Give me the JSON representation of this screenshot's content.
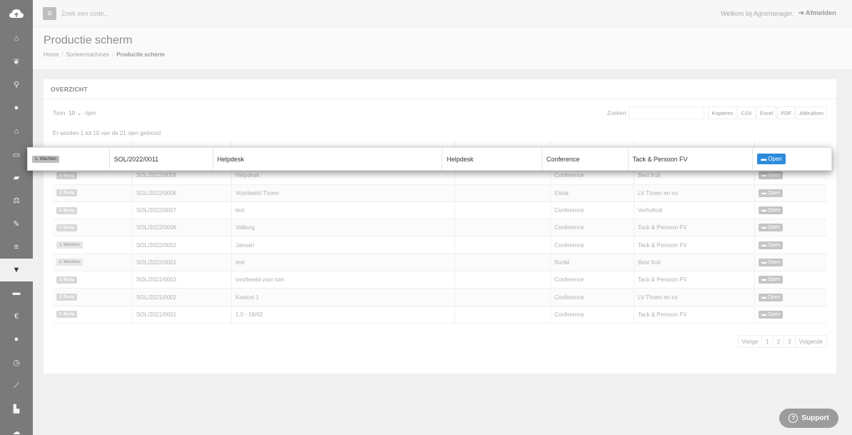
{
  "sidebar": {
    "logo_icon": "cloud-icon",
    "items": [
      {
        "icon": "home-icon",
        "glyph": "⌂"
      },
      {
        "icon": "leaf-icon",
        "glyph": "❦"
      },
      {
        "icon": "map-marker-icon",
        "glyph": "⚲"
      },
      {
        "icon": "tint-icon",
        "glyph": "●"
      },
      {
        "icon": "bank-icon",
        "glyph": "⌂"
      },
      {
        "icon": "basket-icon",
        "glyph": "▭"
      },
      {
        "icon": "book-icon",
        "glyph": "▰"
      },
      {
        "icon": "balance-scale-icon",
        "glyph": "⚖"
      },
      {
        "icon": "wrench-icon",
        "glyph": "✎"
      },
      {
        "icon": "list-icon",
        "glyph": "≡"
      },
      {
        "icon": "filter-icon",
        "glyph": "▼"
      },
      {
        "icon": "truck-icon",
        "glyph": "▬"
      },
      {
        "icon": "euro-icon",
        "glyph": "€"
      },
      {
        "icon": "user-icon",
        "glyph": "●"
      },
      {
        "icon": "clock-icon",
        "glyph": "◷"
      },
      {
        "icon": "line-chart-icon",
        "glyph": "⟋"
      },
      {
        "icon": "industry-icon",
        "glyph": "▙"
      },
      {
        "icon": "cloud-icon",
        "glyph": "☁"
      }
    ]
  },
  "topbar": {
    "search_placeholder": "Zoek een code...",
    "welcome": "Welkom bij Agromanager.",
    "logout": "Afmelden"
  },
  "page": {
    "title": "Productie scherm",
    "breadcrumb": [
      "Home",
      "Sorteermachines",
      "Productie scherm"
    ]
  },
  "panel": {
    "title": "OVERZICHT",
    "show_label": "Toon",
    "page_length": "10",
    "rows_label": "rijen",
    "search_label": "Zoeken",
    "export_buttons": [
      "Kopieren",
      "CSV",
      "Excel",
      "PDF",
      "Afdrukken"
    ],
    "info": "Er worden 1 tot 10 van de 21 rijen getoond"
  },
  "table": {
    "rows": [
      {
        "status": "1. Wachten",
        "code": "SOL/2022/0011",
        "name": "Helpdesk",
        "ref": "Helpdesk",
        "variety": "Conference",
        "customer": "Tack & Persoon FV",
        "action": "Open"
      },
      {
        "status": "2. Bezig",
        "code": "SOL/2022/0009",
        "name": "Helpdesk",
        "ref": "",
        "variety": "Conference",
        "customer": "Best fruit",
        "action": "Open"
      },
      {
        "status": "2. Bezig",
        "code": "SOL/2022/0008",
        "name": "Voorbeeld Thoen",
        "ref": "",
        "variety": "Elstar",
        "customer": "LV Thoen en co",
        "action": "Open"
      },
      {
        "status": "2. Bezig",
        "code": "SOL/2022/0007",
        "name": "test",
        "ref": "",
        "variety": "Conference",
        "customer": "Verhofruit",
        "action": "Open"
      },
      {
        "status": "2. Bezig",
        "code": "SOL/2022/0006",
        "name": "Valburg",
        "ref": "",
        "variety": "Conference",
        "customer": "Tack & Persoon FV",
        "action": "Open"
      },
      {
        "status": "1. Wachten",
        "code": "SOL/2022/0002",
        "name": "Januari",
        "ref": "",
        "variety": "Conference",
        "customer": "Tack & Persoon FV",
        "action": "Open"
      },
      {
        "status": "1. Wachten",
        "code": "SOL/2022/0001",
        "name": "test",
        "ref": "",
        "variety": "Burlat",
        "customer": "Best fruit",
        "action": "Open"
      },
      {
        "status": "2. Bezig",
        "code": "SOL/2021/0003",
        "name": "voorbeeld voor tom",
        "ref": "",
        "variety": "Conference",
        "customer": "Tack & Persoon FV",
        "action": "Open"
      },
      {
        "status": "2. Bezig",
        "code": "SOL/2021/0002",
        "name": "Koelcel 1",
        "ref": "",
        "variety": "Conference",
        "customer": "LV Thoen en co",
        "action": "Open"
      },
      {
        "status": "2. Bezig",
        "code": "SOL/2021/0001",
        "name": "1.0 - 18/02",
        "ref": "",
        "variety": "Conference",
        "customer": "Tack & Persoon FV",
        "action": "Open"
      }
    ]
  },
  "pagination": {
    "prev": "Vorige",
    "pages": [
      "1",
      "2",
      "3"
    ],
    "next": "Volgende"
  },
  "support": {
    "label": "Support"
  },
  "colors": {
    "sidebar": "#7a7a7a",
    "open_button_active": "#2e8bdc"
  }
}
